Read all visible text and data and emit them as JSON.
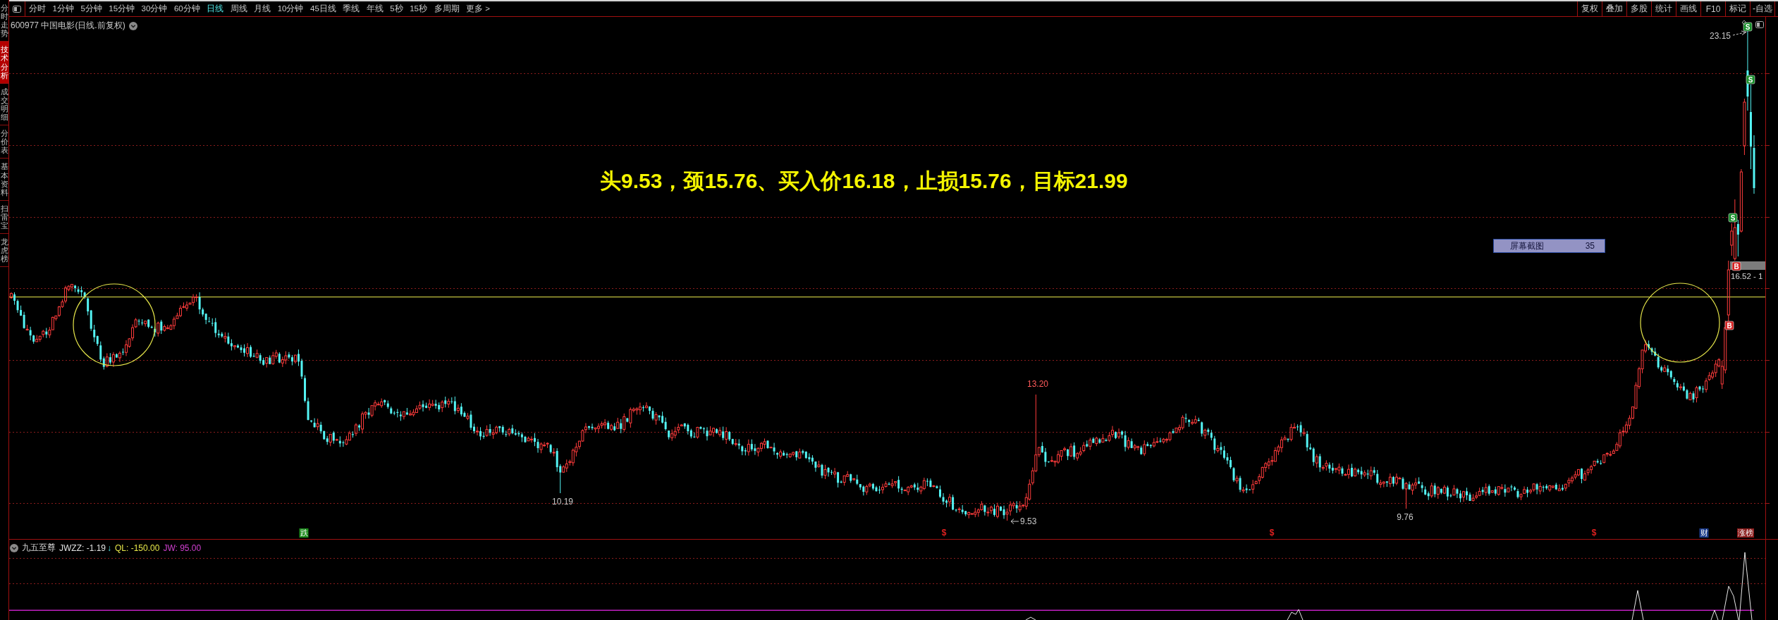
{
  "sidebar": {
    "tabs": [
      {
        "label": "分时走势",
        "selected": false
      },
      {
        "label": "技术分析",
        "selected": true
      },
      {
        "label": "成交明细",
        "selected": false
      },
      {
        "label": "分价表",
        "selected": false
      },
      {
        "label": "基本资料",
        "selected": false
      },
      {
        "label": "扫雷宝",
        "selected": false
      },
      {
        "label": "龙虎榜",
        "selected": false
      }
    ]
  },
  "toolbar": {
    "periods": [
      {
        "label": "分时",
        "selected": false
      },
      {
        "label": "1分钟",
        "selected": false
      },
      {
        "label": "5分钟",
        "selected": false
      },
      {
        "label": "15分钟",
        "selected": false
      },
      {
        "label": "30分钟",
        "selected": false
      },
      {
        "label": "60分钟",
        "selected": false
      },
      {
        "label": "日线",
        "selected": true
      },
      {
        "label": "周线",
        "selected": false
      },
      {
        "label": "月线",
        "selected": false
      },
      {
        "label": "10分钟",
        "selected": false
      },
      {
        "label": "45日线",
        "selected": false
      },
      {
        "label": "季线",
        "selected": false
      },
      {
        "label": "年线",
        "selected": false
      },
      {
        "label": "5秒",
        "selected": false
      },
      {
        "label": "15秒",
        "selected": false
      },
      {
        "label": "多周期",
        "selected": false
      },
      {
        "label": "更多 >",
        "selected": false
      }
    ],
    "tools": [
      "复权",
      "叠加",
      "多股",
      "统计",
      "画线",
      "F10",
      "标记",
      "-自选"
    ]
  },
  "chart": {
    "title": "600977 中国电影(日线.前复权)",
    "annotation": "头9.53，颈15.76、买入价16.18，止损15.76，目标21.99",
    "price_labels": [
      {
        "text": "23.15",
        "color": "#c8c8c8"
      },
      {
        "text": "13.20",
        "color": "#ff5a5a"
      },
      {
        "text": "10.19",
        "color": "#c8c8c8"
      },
      {
        "text": "9.53",
        "color": "#c8c8c8"
      },
      {
        "text": "9.76",
        "color": "#c8c8c8"
      }
    ],
    "signals": [
      {
        "label": "S",
        "kind": "sell"
      },
      {
        "label": "S",
        "kind": "sell"
      },
      {
        "label": "S",
        "kind": "sell"
      },
      {
        "label": "B",
        "kind": "buy"
      },
      {
        "label": "B",
        "kind": "buy"
      }
    ],
    "position_label": "16.52 - 1",
    "screenshot_tooltip": {
      "label": "屏幕截图",
      "value": "35"
    },
    "events": [
      {
        "label": "跌",
        "kind": "badge",
        "color": "#1c8c1c"
      },
      {
        "label": "$",
        "kind": "glyph",
        "color": "#e02020"
      },
      {
        "label": "$",
        "kind": "glyph",
        "color": "#e02020"
      },
      {
        "label": "$",
        "kind": "glyph",
        "color": "#e02020"
      },
      {
        "label": "财",
        "kind": "badge",
        "color": "#1c3c8c"
      },
      {
        "label": "涨榜",
        "kind": "badge",
        "color": "#8c1c1c"
      }
    ]
  },
  "indicator": {
    "name": "九五至尊",
    "values": [
      {
        "text": "JWZZ: -1.19",
        "color": "#e0e0e0",
        "arrow": "↓"
      },
      {
        "text": "QL: -150.00",
        "color": "#e8e84a"
      },
      {
        "text": "JW: 95.00",
        "color": "#d040d0"
      }
    ]
  }
}
